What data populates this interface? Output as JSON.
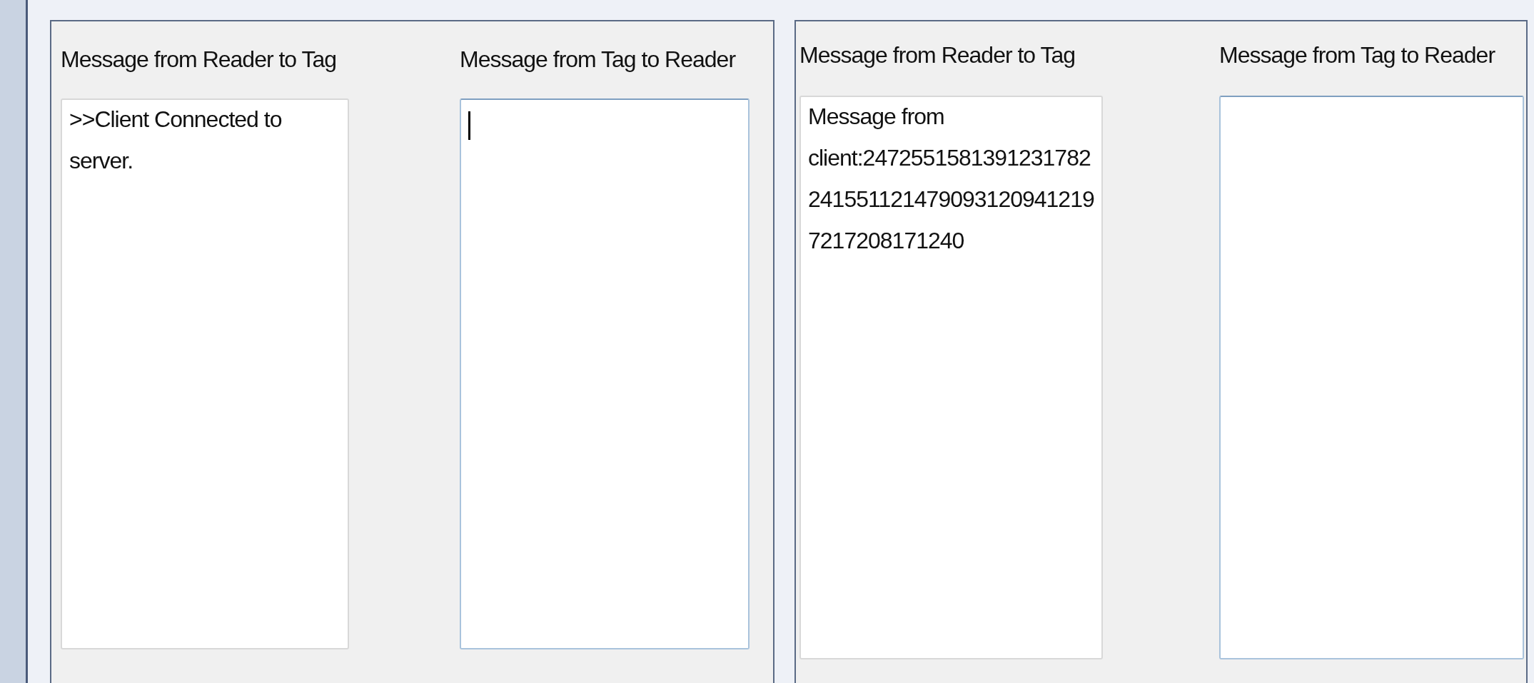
{
  "panels": [
    {
      "fields": [
        {
          "label": "Message from Reader to Tag",
          "value": ">>Client Connected to server.",
          "highlighted": false,
          "focused": false
        },
        {
          "label": "Message from Tag to Reader",
          "highlighted": true,
          "focused": true
        }
      ]
    },
    {
      "fields": [
        {
          "label": "Message from Reader to Tag",
          "value": "Message from client:24725515813912317822415511214790931209412197217208171240",
          "highlighted": false,
          "focused": false
        },
        {
          "label": "Message from Tag to Reader",
          "highlighted": true,
          "focused": false
        }
      ]
    }
  ]
}
